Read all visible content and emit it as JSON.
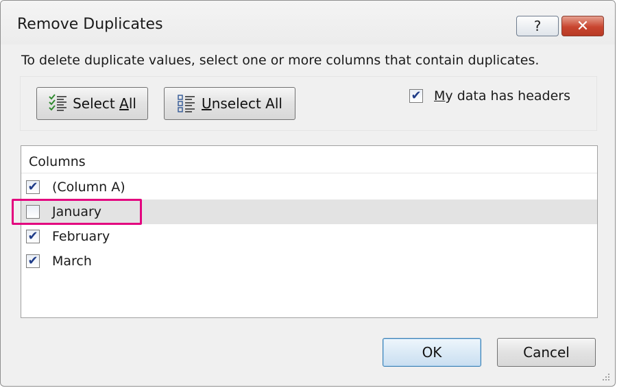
{
  "window": {
    "title": "Remove Duplicates",
    "help_glyph": "?",
    "close_glyph": "✕"
  },
  "instruction": "To delete duplicate values, select one or more columns that contain duplicates.",
  "toolbar": {
    "select_all": {
      "prefix": "",
      "mnemonic": "Select ",
      "underlined": "A",
      "suffix": "ll",
      "icon": "select-all-icon"
    },
    "unselect_all": {
      "underlined": "U",
      "suffix": "nselect All",
      "icon": "unselect-all-icon"
    }
  },
  "headers_option": {
    "label_underlined": "M",
    "label_rest": "y data has headers",
    "checked": true
  },
  "columns": {
    "header": "Columns",
    "items": [
      {
        "label": "(Column A)",
        "checked": true
      },
      {
        "label": "January",
        "checked": false,
        "selected": true
      },
      {
        "label": "February",
        "checked": true
      },
      {
        "label": "March",
        "checked": true
      }
    ]
  },
  "footer": {
    "ok_label": "OK",
    "cancel_label": "Cancel"
  },
  "colors": {
    "highlight": "#e3007e",
    "check": "#1f3c88"
  }
}
